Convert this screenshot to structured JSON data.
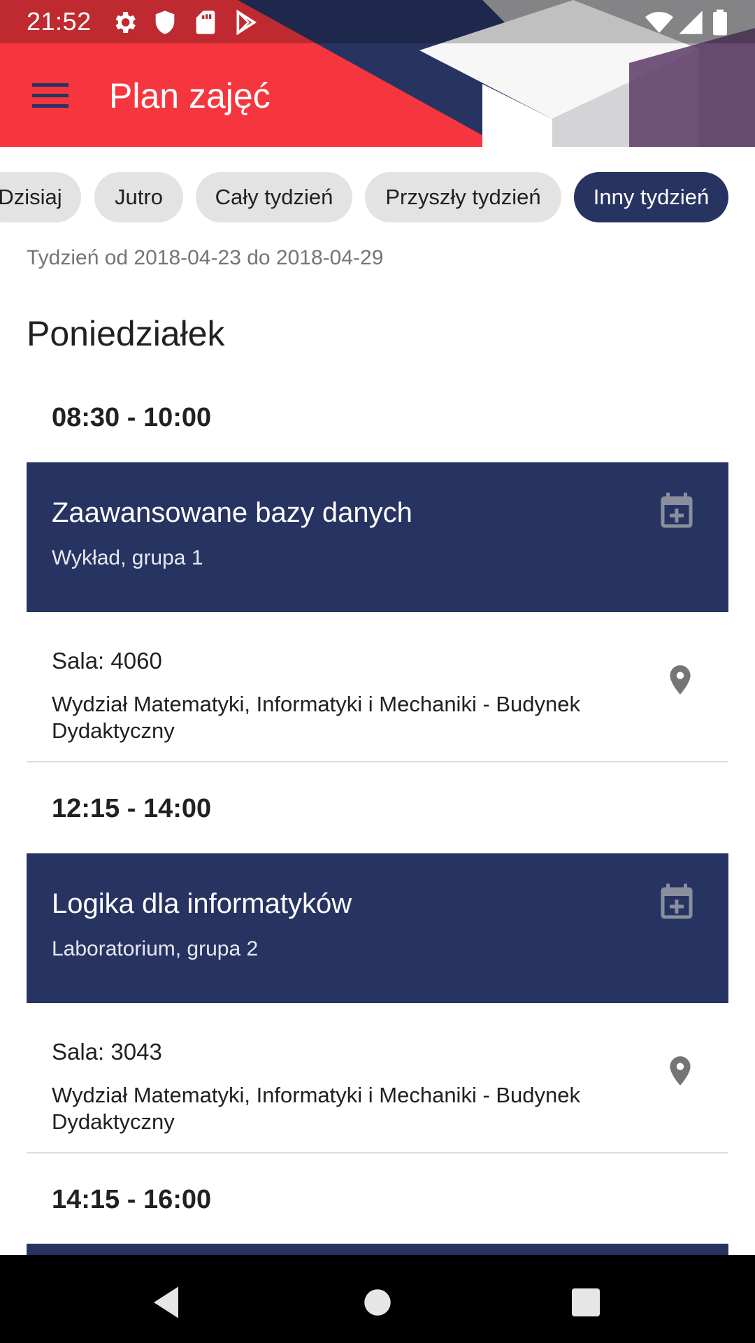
{
  "status_bar": {
    "time": "21:52",
    "left_icons": [
      "settings-icon",
      "shield-icon",
      "sd-card-icon",
      "play-store-icon"
    ],
    "right_icons": [
      "wifi-icon",
      "signal-icon",
      "battery-icon"
    ]
  },
  "toolbar": {
    "title": "Plan zajęć",
    "menu_icon": "hamburger-menu-icon"
  },
  "chips": [
    {
      "label": "Dzisiaj",
      "active": false
    },
    {
      "label": "Jutro",
      "active": false
    },
    {
      "label": "Cały tydzień",
      "active": false
    },
    {
      "label": "Przyszły tydzień",
      "active": false
    },
    {
      "label": "Inny tydzień",
      "active": true
    }
  ],
  "week_range": "Tydzień od 2018-04-23 do 2018-04-29",
  "day": {
    "title": "Poniedziałek",
    "classes": [
      {
        "time": "08:30 - 10:00",
        "title": "Zaawansowane bazy danych",
        "subtitle": "Wykład, grupa 1",
        "room": "Sala: 4060",
        "building": "Wydział Matematyki, Informatyki i Mechaniki - Budynek Dydaktyczny"
      },
      {
        "time": "12:15 - 14:00",
        "title": "Logika dla informatyków",
        "subtitle": "Laboratorium, grupa 2",
        "room": "Sala: 3043",
        "building": "Wydział Matematyki, Informatyki i Mechaniki - Budynek Dydaktyczny"
      },
      {
        "time": "14:15 - 16:00"
      }
    ]
  },
  "colors": {
    "accent_red": "#f5363e",
    "navy": "#273462",
    "chip_bg": "#e3e3e3"
  },
  "nav_bar": {
    "icons": [
      "back-icon",
      "home-icon",
      "recents-icon"
    ]
  }
}
